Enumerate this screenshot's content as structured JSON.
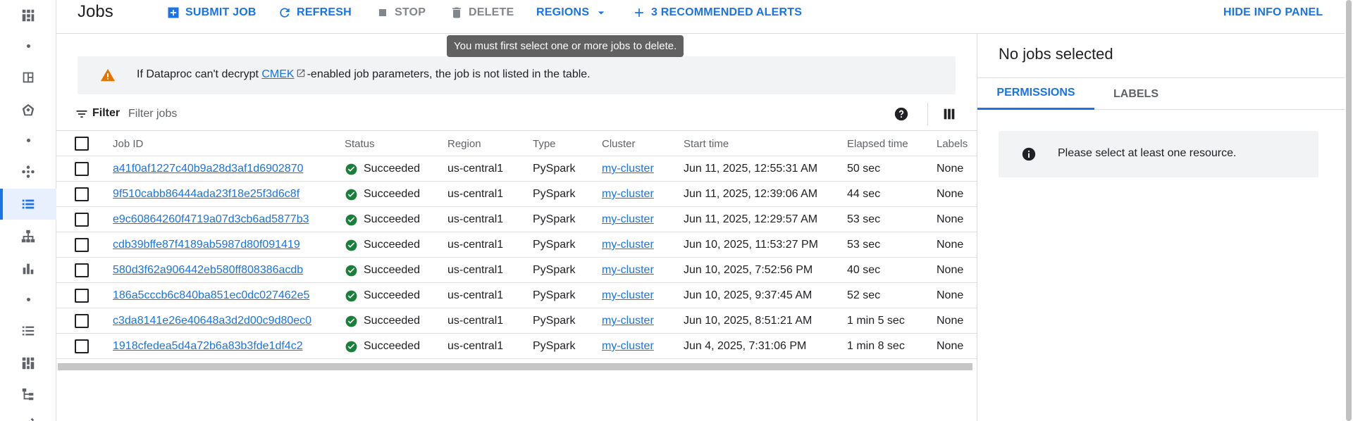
{
  "toolbar": {
    "title": "Jobs",
    "submit_job": "SUBMIT JOB",
    "refresh": "REFRESH",
    "stop": "STOP",
    "delete": "DELETE",
    "regions": "REGIONS",
    "recommended_alerts": "3 RECOMMENDED ALERTS",
    "hide_info_panel": "HIDE INFO PANEL",
    "tooltip": "You must first select one or more jobs to delete."
  },
  "banner": {
    "text_before": "If Dataproc can't decrypt ",
    "link": "CMEK",
    "text_after": "-enabled job parameters, the job is not listed in the table."
  },
  "filter": {
    "label": "Filter",
    "placeholder": "Filter jobs"
  },
  "table": {
    "headers": {
      "job_id": "Job ID",
      "status": "Status",
      "region": "Region",
      "type": "Type",
      "cluster": "Cluster",
      "start_time": "Start time",
      "elapsed_time": "Elapsed time",
      "labels": "Labels"
    },
    "rows": [
      {
        "job_id": "a41f0af1227c40b9a28d3af1d6902870",
        "status": "Succeeded",
        "region": "us-central1",
        "type": "PySpark",
        "cluster": "my-cluster",
        "start_time": "Jun 11, 2025, 12:55:31 AM",
        "elapsed": "50 sec",
        "labels": "None"
      },
      {
        "job_id": "9f510cabb86444ada23f18e25f3d6c8f",
        "status": "Succeeded",
        "region": "us-central1",
        "type": "PySpark",
        "cluster": "my-cluster",
        "start_time": "Jun 11, 2025, 12:39:06 AM",
        "elapsed": "44 sec",
        "labels": "None"
      },
      {
        "job_id": "e9c60864260f4719a07d3cb6ad5877b3",
        "status": "Succeeded",
        "region": "us-central1",
        "type": "PySpark",
        "cluster": "my-cluster",
        "start_time": "Jun 11, 2025, 12:29:57 AM",
        "elapsed": "53 sec",
        "labels": "None"
      },
      {
        "job_id": "cdb39bffe87f4189ab5987d80f091419",
        "status": "Succeeded",
        "region": "us-central1",
        "type": "PySpark",
        "cluster": "my-cluster",
        "start_time": "Jun 10, 2025, 11:53:27 PM",
        "elapsed": "53 sec",
        "labels": "None"
      },
      {
        "job_id": "580d3f62a906442eb580ff808386acdb",
        "status": "Succeeded",
        "region": "us-central1",
        "type": "PySpark",
        "cluster": "my-cluster",
        "start_time": "Jun 10, 2025, 7:52:56 PM",
        "elapsed": "40 sec",
        "labels": "None"
      },
      {
        "job_id": "186a5cccb6c840ba851ec0dc027462e5",
        "status": "Succeeded",
        "region": "us-central1",
        "type": "PySpark",
        "cluster": "my-cluster",
        "start_time": "Jun 10, 2025, 9:37:45 AM",
        "elapsed": "52 sec",
        "labels": "None"
      },
      {
        "job_id": "c3da8141e26e40648a3d2d00c9d80ec0",
        "status": "Succeeded",
        "region": "us-central1",
        "type": "PySpark",
        "cluster": "my-cluster",
        "start_time": "Jun 10, 2025, 8:51:21 AM",
        "elapsed": "1 min 5 sec",
        "labels": "None"
      },
      {
        "job_id": "1918cfedea5d4a72b6a83b3fde1df4c2",
        "status": "Succeeded",
        "region": "us-central1",
        "type": "PySpark",
        "cluster": "my-cluster",
        "start_time": "Jun 4, 2025, 7:31:06 PM",
        "elapsed": "1 min 8 sec",
        "labels": "None"
      }
    ]
  },
  "info_panel": {
    "title": "No jobs selected",
    "tabs": [
      "PERMISSIONS",
      "LABELS"
    ],
    "active_tab": "PERMISSIONS",
    "message": "Please select at least one resource."
  },
  "colors": {
    "accent": "#1a73e8",
    "success": "#188038",
    "warning": "#e37400",
    "tooltip_bg": "#616161"
  },
  "icons": {
    "rail": [
      "dashboard-icon",
      "dot",
      "layout-icon",
      "spark-icon",
      "dot",
      "workflow-icon",
      "jobs-list-icon",
      "hierarchy-icon",
      "bar-chart-icon",
      "dot",
      "list-icon",
      "grid-icon",
      "tree-icon",
      "edit-icon"
    ],
    "toolbar": [
      "add-box-icon",
      "refresh-icon",
      "stop-icon",
      "delete-icon",
      "dropdown-arrow-icon",
      "plus-icon"
    ],
    "status": "check-circle-icon",
    "banner": "warning-icon",
    "panel": "info-icon"
  }
}
